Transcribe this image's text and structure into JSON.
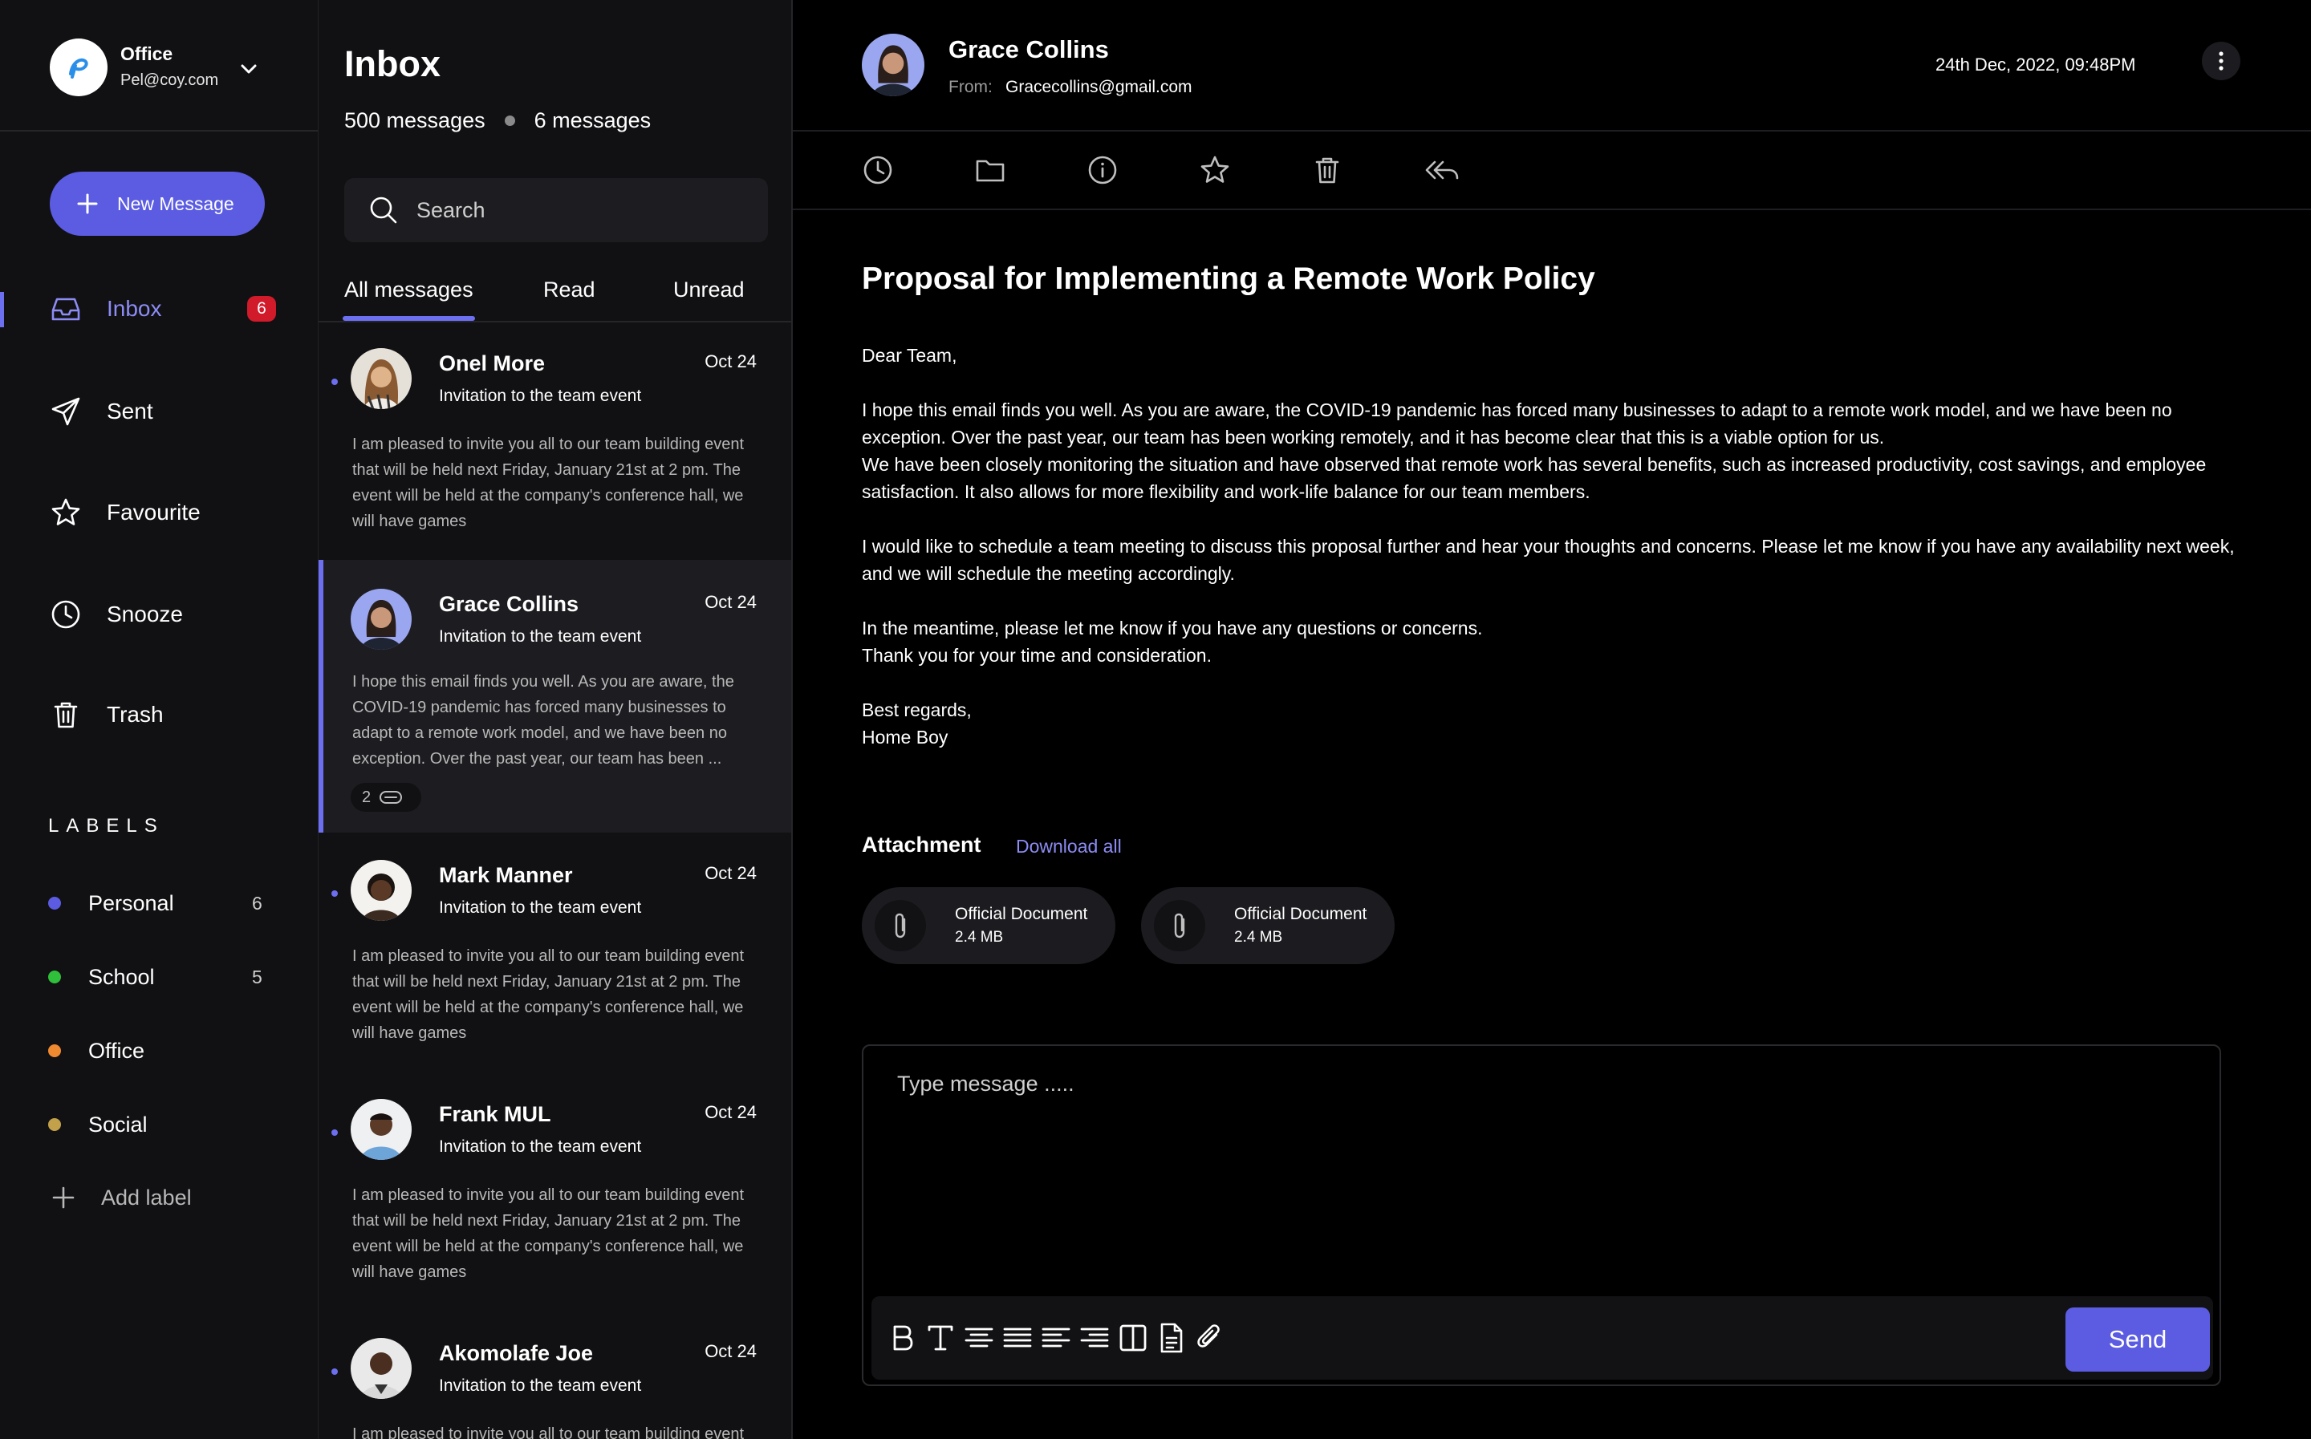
{
  "account": {
    "name": "Office",
    "email": "Pel@coy.com",
    "logo_icon": "brand-logo-icon"
  },
  "compose": {
    "label": "New Message"
  },
  "nav": [
    {
      "label": "Inbox",
      "icon": "inbox-icon",
      "badge": "6",
      "active": true
    },
    {
      "label": "Sent",
      "icon": "send-icon"
    },
    {
      "label": "Favourite",
      "icon": "star-icon"
    },
    {
      "label": "Snooze",
      "icon": "clock-icon"
    },
    {
      "label": "Trash",
      "icon": "trash-icon"
    }
  ],
  "labels": {
    "title": "LABELS",
    "items": [
      {
        "label": "Personal",
        "count": "6",
        "color": "#5b5ce2"
      },
      {
        "label": "School",
        "count": "5",
        "color": "#2fbf3a"
      },
      {
        "label": "Office",
        "count": "",
        "color": "#f08a30"
      },
      {
        "label": "Social",
        "count": "",
        "color": "#c2a14a"
      }
    ],
    "add_label": "Add label"
  },
  "list": {
    "title": "Inbox",
    "total": "500 messages",
    "unread": "6 messages",
    "search_placeholder": "Search",
    "tabs": [
      "All messages",
      "Read",
      "Unread"
    ],
    "mails": [
      {
        "sender": "Onel  More",
        "date": "Oct 24",
        "subject": "Invitation to the team event",
        "preview": "I am pleased to invite you all to our team building event that will be held next Friday, January 21st at 2 pm. The event will be held at the company's conference hall, we will have games"
      },
      {
        "sender": "Grace Collins",
        "date": "Oct 24",
        "subject": "Invitation to the team event",
        "preview": "I hope this email finds you well. As you are aware, the COVID-19 pandemic has forced many businesses to adapt to a remote work model, and we have been no exception. Over the past year, our team has been ...",
        "attachments": "2"
      },
      {
        "sender": "Mark Manner",
        "date": "Oct 24",
        "subject": "Invitation to the team event",
        "preview": "I am pleased to invite you all to our team building event that will be held next Friday, January 21st at 2 pm. The event will be held at the company's conference hall, we will have games"
      },
      {
        "sender": "Frank MUL",
        "date": "Oct 24",
        "subject": "Invitation to the team event",
        "preview": "I am pleased to invite you all to our team building event that will be held next Friday, January 21st at 2 pm. The event will be held at the company's conference hall, we will have games"
      },
      {
        "sender": "Akomolafe Joe",
        "date": "Oct 24",
        "subject": "Invitation to the team event",
        "preview": "I am pleased to invite you all to our team building event"
      }
    ]
  },
  "reader": {
    "sender": "Grace Collins",
    "from_label": "From:",
    "from_email": "Gracecollins@gmail.com",
    "timestamp": "24th Dec, 2022, 09:48PM",
    "toolbar_icons": [
      "clock-icon",
      "folder-icon",
      "info-icon",
      "star-icon",
      "trash-icon",
      "reply-all-icon"
    ],
    "subject": "Proposal for Implementing a Remote Work Policy",
    "greeting": "Dear Team,",
    "para1a": "I hope this email finds you well. As you are aware, the COVID-19 pandemic has forced many businesses to adapt to a remote work model, and we have been no exception. Over the past year, our team has been working remotely, and it has become clear that this is a viable option for us.",
    "para1b": "We have been closely monitoring the situation and have observed that remote work has several benefits, such as increased productivity, cost savings, and employee satisfaction. It also allows for more flexibility and work-life balance for our team members.",
    "para2": "I would like to schedule a team meeting to discuss this proposal further and hear your thoughts and concerns. Please let me know if you have any availability next week, and we will schedule the meeting accordingly.",
    "para3a": "In the meantime, please let me know if you have any questions or concerns.",
    "para3b": "Thank you for your time and consideration.",
    "signoff": "Best regards,",
    "signature": "Home Boy",
    "attachment_title": "Attachment",
    "download_all": "Download all",
    "files": [
      {
        "name": "Official Document",
        "size": "2.4 MB"
      },
      {
        "name": "Official Document",
        "size": "2.4 MB"
      }
    ]
  },
  "composer": {
    "placeholder": "Type message .....",
    "format_icons": [
      "bold-icon",
      "text-icon",
      "align-center-icon",
      "align-justify-icon",
      "align-left-icon",
      "align-right-icon",
      "columns-icon",
      "document-icon",
      "paperclip-icon"
    ],
    "send_label": "Send"
  },
  "colors": {
    "accent": "#5b5ce2",
    "badge": "#d11a2a",
    "panel": "#111113",
    "background": "#000000"
  }
}
